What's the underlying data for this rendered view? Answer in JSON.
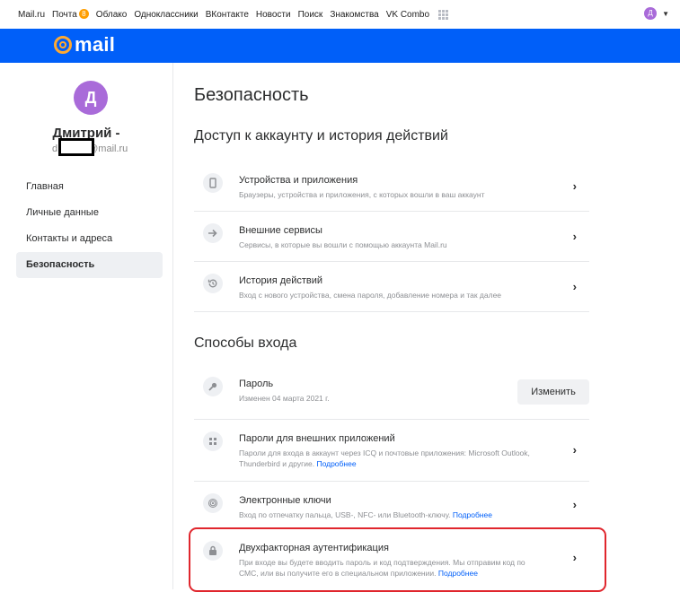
{
  "portal": {
    "links": [
      "Mail.ru",
      "Почта",
      "Облако",
      "Одноклассники",
      "ВКонтакте",
      "Новости",
      "Поиск",
      "Знакомства",
      "VK Combo"
    ],
    "mail_badge": "8",
    "user_initial": "Д"
  },
  "header": {
    "logo_word": "mail"
  },
  "sidebar": {
    "avatar_letter": "Д",
    "user_name": "Дмитрий -",
    "email_prefix": "d",
    "email_domain": "@mail.ru",
    "nav": [
      "Главная",
      "Личные данные",
      "Контакты и адреса",
      "Безопасность"
    ],
    "active_nav": "Безопасность"
  },
  "main": {
    "page_title": "Безопасность",
    "access_section": {
      "title": "Доступ к аккаунту и история действий",
      "items": [
        {
          "title": "Устройства и приложения",
          "subtitle": "Браузеры, устройства и приложения, с которых вошли в ваш аккаунт",
          "icon": "device-icon"
        },
        {
          "title": "Внешние сервисы",
          "subtitle": "Сервисы, в которые вы вошли с помощью аккаунта Mail.ru",
          "icon": "arrow-right-icon"
        },
        {
          "title": "История действий",
          "subtitle": "Вход с нового устройства, смена пароля, добавление номера и так далее",
          "icon": "history-icon"
        }
      ]
    },
    "login_section": {
      "title": "Способы входа",
      "password": {
        "title": "Пароль",
        "subtitle": "Изменен 04 марта 2021 г.",
        "button": "Изменить",
        "icon": "key-icon"
      },
      "app_passwords": {
        "title": "Пароли для внешних приложений",
        "subtitle": "Пароли для входа в аккаунт через ICQ и почтовые приложения: Microsoft Outlook, Thunderbird и другие.",
        "more": "Подробнее",
        "icon": "apps-icon"
      },
      "keys": {
        "title": "Электронные ключи",
        "subtitle": "Вход по отпечатку пальца, USB-, NFC- или Bluetooth-ключу.",
        "more": "Подробнее",
        "icon": "fingerprint-icon"
      },
      "two_factor": {
        "title": "Двухфакторная аутентификация",
        "subtitle": "При входе вы будете вводить пароль и код подтверждения. Мы отправим код по СМС, или вы получите его в специальном приложении.",
        "more": "Подробнее",
        "icon": "lock-icon"
      }
    }
  },
  "colors": {
    "brand_blue": "#005ff9",
    "avatar_purple": "#a96bd9",
    "highlight_red": "#e0262d",
    "link_blue": "#005ff9"
  }
}
